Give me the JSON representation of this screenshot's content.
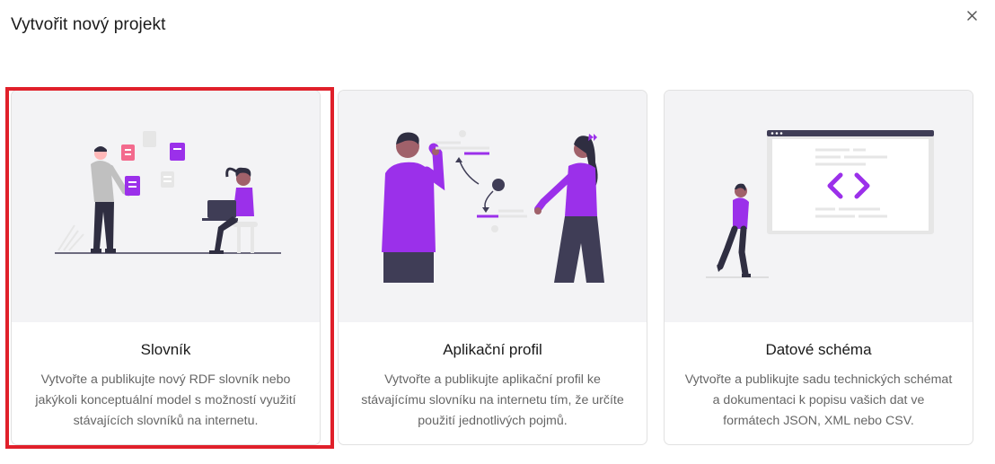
{
  "dialog": {
    "title": "Vytvořit nový projekt",
    "close_icon": "close-icon"
  },
  "cards": [
    {
      "title": "Slovník",
      "description": "Vytvořte a publikujte nový RDF slovník nebo jakýkoli konceptuální model s možností využití stávajících slovníků na internetu.",
      "selected": true
    },
    {
      "title": "Aplikační profil",
      "description": "Vytvořte a publikujte aplikační profil ke stávajícímu slovníku na internetu tím, že určíte použití jednotlivých pojmů.",
      "selected": false
    },
    {
      "title": "Datové schéma",
      "description": "Vytvořte a publikujte sadu technických schémat a dokumentaci k popisu vašich dat ve formátech JSON, XML nebo CSV.",
      "selected": false
    }
  ],
  "colors": {
    "accent": "#9b30ea",
    "selection_border": "#e0202a",
    "illustration_bg": "#f3f3f5"
  }
}
